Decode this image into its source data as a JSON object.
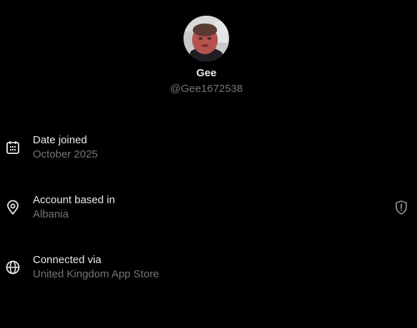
{
  "profile": {
    "display_name": "Gee",
    "handle": "@Gee1672538"
  },
  "details": [
    {
      "icon": "calendar-icon",
      "label": "Date joined",
      "value": "October 2025"
    },
    {
      "icon": "location-pin-icon",
      "label": "Account based in",
      "value": "Albania",
      "badge_icon": "shield-exclamation-icon"
    },
    {
      "icon": "globe-icon",
      "label": "Connected via",
      "value": "United Kingdom App Store"
    }
  ],
  "colors": {
    "background": "#000000",
    "primary_text": "#e7e9ea",
    "secondary_text": "#71767b"
  }
}
